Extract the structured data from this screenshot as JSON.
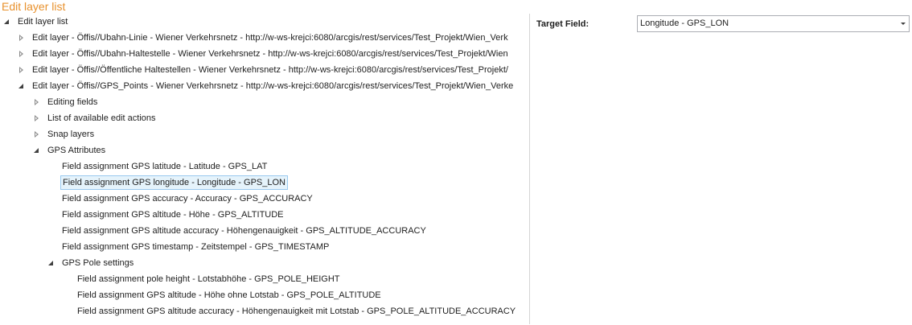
{
  "page": {
    "title": "Edit layer list"
  },
  "tree": {
    "root": {
      "label": "Edit layer list"
    },
    "layers": [
      {
        "label": "Edit layer - Öffis//Ubahn-Linie - Wiener Verkehrsnetz - http://w-ws-krejci:6080/arcgis/rest/services/Test_Projekt/Wien_Verk"
      },
      {
        "label": "Edit layer - Öffis//Ubahn-Haltestelle - Wiener Verkehrsnetz - http://w-ws-krejci:6080/arcgis/rest/services/Test_Projekt/Wien"
      },
      {
        "label": "Edit layer - Öffis//Öffentliche Haltestellen - Wiener Verkehrsnetz - http://w-ws-krejci:6080/arcgis/rest/services/Test_Projekt/"
      },
      {
        "label": "Edit layer - Öffis//GPS_Points - Wiener Verkehrsnetz - http://w-ws-krejci:6080/arcgis/rest/services/Test_Projekt/Wien_Verke"
      }
    ],
    "sections": [
      {
        "label": "Editing fields"
      },
      {
        "label": "List of available edit actions"
      },
      {
        "label": "Snap layers"
      },
      {
        "label": "GPS Attributes"
      }
    ],
    "gps_fields": [
      {
        "label": "Field assignment GPS latitude - Latitude - GPS_LAT"
      },
      {
        "label": "Field assignment GPS longitude - Longitude - GPS_LON"
      },
      {
        "label": "Field assignment GPS accuracy - Accuracy - GPS_ACCURACY"
      },
      {
        "label": "Field assignment GPS altitude - Höhe - GPS_ALTITUDE"
      },
      {
        "label": "Field assignment GPS altitude accuracy - Höhengenauigkeit - GPS_ALTITUDE_ACCURACY"
      },
      {
        "label": "Field assignment GPS timestamp - Zeitstempel - GPS_TIMESTAMP"
      }
    ],
    "pole_settings": {
      "label": "GPS Pole settings"
    },
    "pole_fields": [
      {
        "label": "Field assignment pole height - Lotstabhöhe - GPS_POLE_HEIGHT"
      },
      {
        "label": "Field assignment GPS altitude - Höhe ohne Lotstab - GPS_POLE_ALTITUDE"
      },
      {
        "label": "Field assignment GPS altitude accuracy - Höhengenauigkeit mit Lotstab - GPS_POLE_ALTITUDE_ACCURACY"
      }
    ]
  },
  "properties": {
    "target_field_label": "Target Field:",
    "target_field_value": "Longitude - GPS_LON"
  },
  "colors": {
    "title": "#e8912d",
    "selection_bg": "#e5f3fb",
    "selection_border": "#99c9ef"
  }
}
